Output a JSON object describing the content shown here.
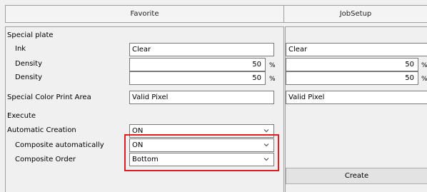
{
  "columns": {
    "favorite": "Favorite",
    "jobsetup": "JobSetup"
  },
  "labels": {
    "special_plate": "Special plate",
    "ink": "Ink",
    "density1": "Density",
    "density2": "Density",
    "special_color_print_area": "Special Color Print Area",
    "execute": "Execute",
    "automatic_creation": "Automatic Creation",
    "composite_automatically": "Composite automatically",
    "composite_order": "Composite Order"
  },
  "favorite": {
    "ink": "Clear",
    "density1": "50",
    "density2": "50",
    "unit": "%",
    "print_area": "Valid Pixel",
    "automatic_creation": "ON",
    "composite_automatically": "ON",
    "composite_order": "Bottom"
  },
  "jobsetup": {
    "ink": "Clear",
    "density1": "50",
    "density2": "50",
    "unit": "%",
    "print_area": "Valid Pixel",
    "create_button": "Create"
  },
  "colors": {
    "highlight": "#e01e1e"
  }
}
